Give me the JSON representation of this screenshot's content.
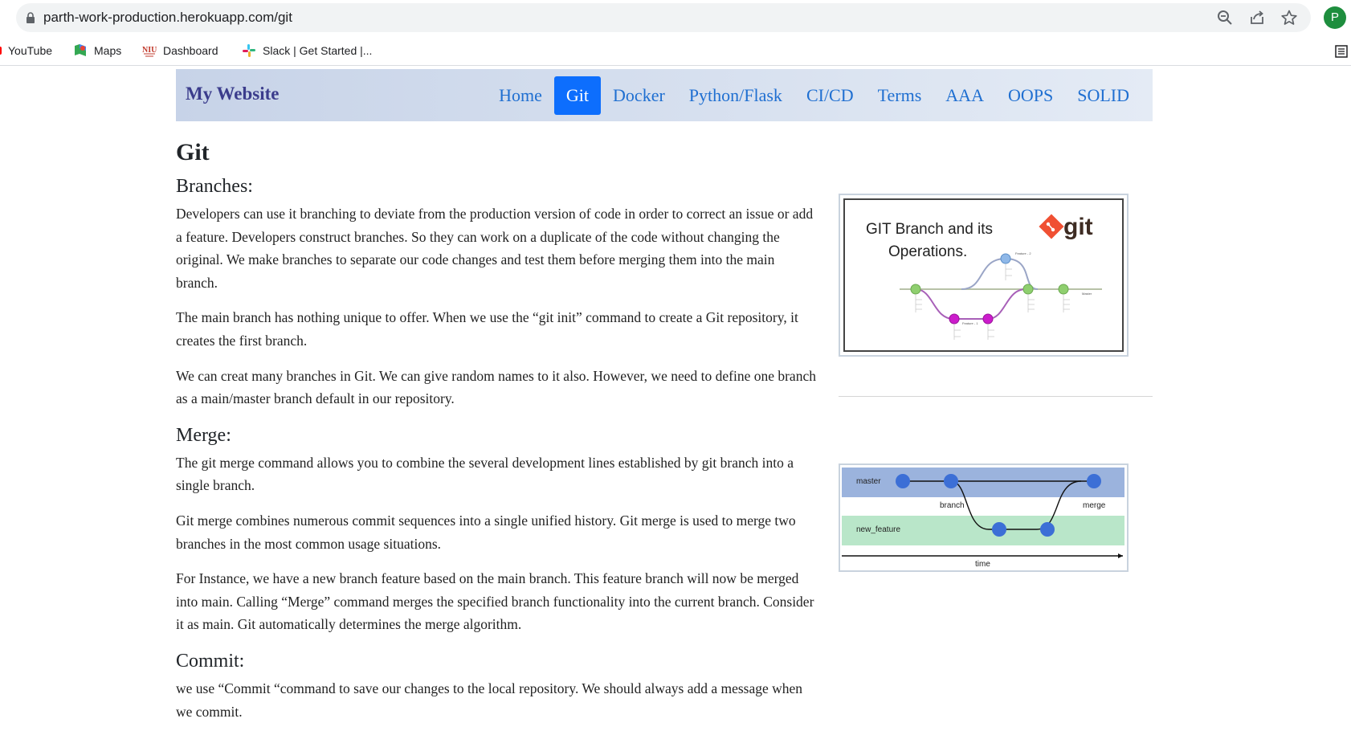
{
  "browser": {
    "url": "parth-work-production.herokuapp.com/git",
    "profile_initial": "P",
    "bookmarks": [
      {
        "label": "YouTube",
        "icon": "youtube-icon"
      },
      {
        "label": "Maps",
        "icon": "maps-icon"
      },
      {
        "label": "Dashboard",
        "icon": "dashboard-icon"
      },
      {
        "label": "Slack | Get Started |...",
        "icon": "slack-icon"
      }
    ]
  },
  "site": {
    "brand": "My Website",
    "nav": [
      {
        "label": "Home",
        "active": false
      },
      {
        "label": "Git",
        "active": true
      },
      {
        "label": "Docker",
        "active": false
      },
      {
        "label": "Python/Flask",
        "active": false
      },
      {
        "label": "CI/CD",
        "active": false
      },
      {
        "label": "Terms",
        "active": false
      },
      {
        "label": "AAA",
        "active": false
      },
      {
        "label": "OOPS",
        "active": false
      },
      {
        "label": "SOLID",
        "active": false
      }
    ],
    "accent_color": "#0d6efd"
  },
  "content": {
    "title": "Git",
    "sections": [
      {
        "heading": "Branches:",
        "paragraphs": [
          "Developers can use it branching to deviate from the production version of code in order to correct an issue or add a feature. Developers construct branches. So they can work on a duplicate of the code without changing the original. We make branches to separate our code changes and test them before merging them into the main branch.",
          "The main branch has nothing unique to offer. When we use the “git init” command to create a Git repository, it creates the first branch.",
          "We can creat many branches in Git. We can give random names to it also. However, we need to define one branch as a main/master branch default in our repository."
        ]
      },
      {
        "heading": "Merge:",
        "paragraphs": [
          "The git merge command allows you to combine the several development lines established by git branch into a single branch.",
          "Git merge combines numerous commit sequences into a single unified history. Git merge is used to merge two branches in the most common usage situations.",
          "For Instance, we have a new branch feature based on the main branch. This feature branch will now be merged into main. Calling “Merge” command merges the specified branch functionality into the current branch. Consider it as main. Git automatically determines the merge algorithm."
        ]
      },
      {
        "heading": "Commit:",
        "paragraphs": [
          "we use “Commit “command to save our changes to the local repository. We should always add a message when we commit."
        ]
      }
    ],
    "figure1": {
      "title_line1": "GIT Branch and its",
      "title_line2": "Operations.",
      "logo_text": "git",
      "label_feature2": "Feature - 2",
      "label_feature1": "Feature - 1",
      "label_master": "Master"
    },
    "figure2": {
      "master_label": "master",
      "feature_label": "new_feature",
      "branch_label": "branch",
      "merge_label": "merge",
      "time_label": "time"
    }
  }
}
